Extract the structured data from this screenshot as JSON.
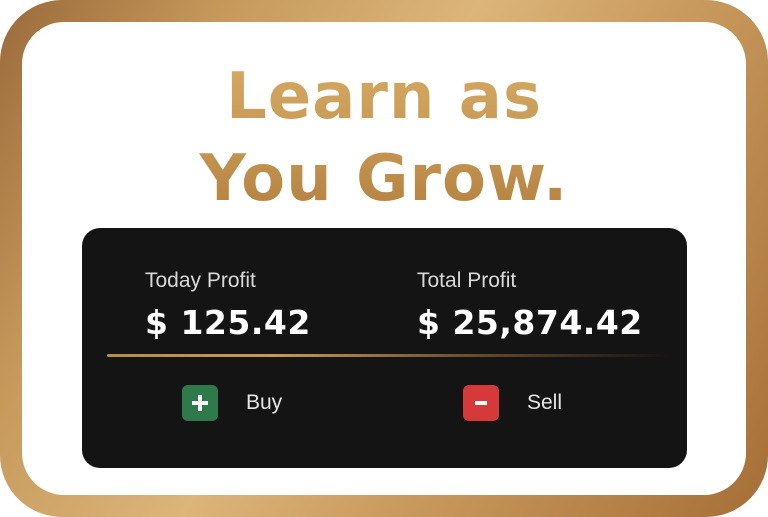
{
  "headline": {
    "line1": "Learn as",
    "line2": "You Grow."
  },
  "profit_card": {
    "today_label": "Today Profit",
    "today_value": "$ 125.42",
    "total_label": "Total Profit",
    "total_value": "$ 25,874.42"
  },
  "actions": {
    "buy_label": "Buy",
    "sell_label": "Sell"
  },
  "icons": {
    "buy": "plus-icon",
    "sell": "minus-icon"
  },
  "colors": {
    "frame_gold": "#c99a5e",
    "card_background": "#141414",
    "buy_green": "#2f7a4b",
    "sell_red": "#d6393a"
  }
}
